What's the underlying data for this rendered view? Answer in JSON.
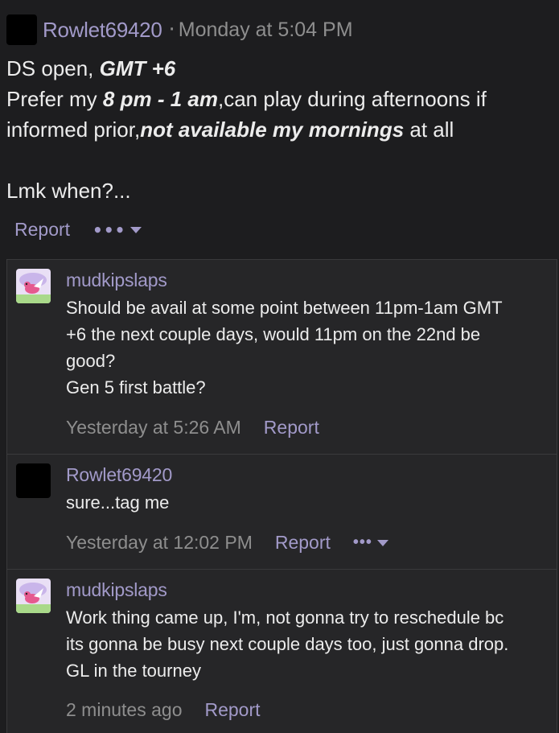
{
  "post": {
    "author": "Rowlet69420",
    "separator": "·",
    "timestamp": "Monday at 5:04 PM",
    "line1_plain": "DS open, ",
    "line1_bold": "GMT +6",
    "line2_plain": "Prefer my ",
    "line2_bold": "8 pm - 1 am",
    "line2_rest": ",can play during afternoons if",
    "line3_plain": "informed prior,",
    "line3_bold": "not available my mornings",
    "line3_rest": " at all",
    "line4": "Lmk when?...",
    "report_label": "Report",
    "more_label": "•••"
  },
  "replies": [
    {
      "author": "mudkipslaps",
      "body_lines": [
        "Should be avail at some point between 11pm-1am GMT",
        "+6 the next couple days, would 11pm on the 22nd be",
        "good?",
        "Gen 5 first battle?"
      ],
      "timestamp": "Yesterday at 5:26 AM",
      "report_label": "Report"
    },
    {
      "author": "Rowlet69420",
      "body_lines": [
        "sure...tag me"
      ],
      "timestamp": "Yesterday at 12:02 PM",
      "report_label": "Report",
      "more_label": "•••"
    },
    {
      "author": "mudkipslaps",
      "body_lines": [
        "Work thing came up, I'm, not gonna try to reschedule bc",
        "its gonna be busy next couple days too, just gonna drop.",
        "GL in the tourney"
      ],
      "timestamp": "2 minutes ago",
      "report_label": "Report"
    }
  ],
  "colors": {
    "background": "#1d1d1f",
    "reply_background": "#262628",
    "link": "#a29ac9",
    "muted": "#8e8e8e",
    "text": "#ececec"
  },
  "icons": {
    "more": "ellipsis-icon",
    "caret": "chevron-down-icon",
    "mudkip_avatar": "pokemon-avatar"
  }
}
